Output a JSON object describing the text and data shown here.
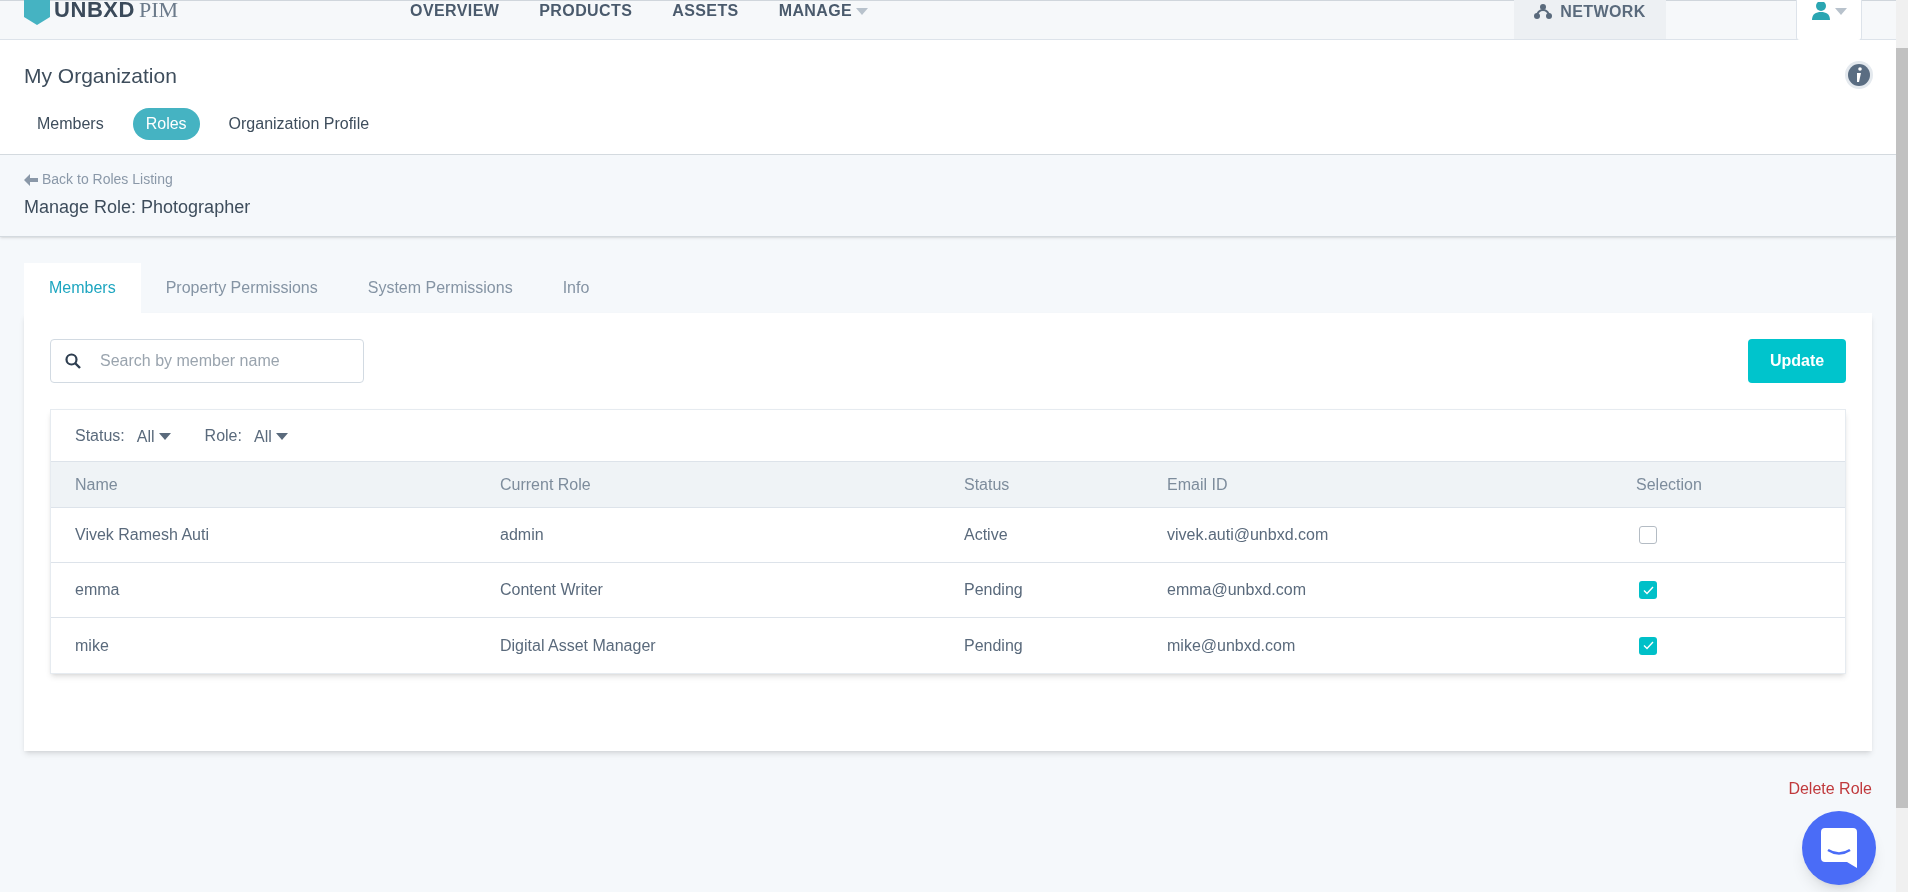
{
  "nav": {
    "logo": "UNBXD",
    "logo_suffix": "PIM",
    "items": [
      {
        "label": "OVERVIEW",
        "dropdown": false
      },
      {
        "label": "PRODUCTS",
        "dropdown": false
      },
      {
        "label": "ASSETS",
        "dropdown": false
      },
      {
        "label": "MANAGE",
        "dropdown": true
      }
    ],
    "network": "NETWORK"
  },
  "header": {
    "title": "My Organization",
    "tabs": [
      {
        "label": "Members",
        "selected": false
      },
      {
        "label": "Roles",
        "selected": true
      },
      {
        "label": "Organization Profile",
        "selected": false
      }
    ]
  },
  "breadcrumb": {
    "back": "Back to Roles Listing",
    "title": "Manage Role: Photographer"
  },
  "tabs": [
    {
      "label": "Members",
      "selected": true
    },
    {
      "label": "Property Permissions",
      "selected": false
    },
    {
      "label": "System Permissions",
      "selected": false
    },
    {
      "label": "Info",
      "selected": false
    }
  ],
  "search": {
    "placeholder": "Search by member name"
  },
  "update_button": "Update",
  "filters": [
    {
      "label": "Status:",
      "value": "All"
    },
    {
      "label": "Role:",
      "value": "All"
    }
  ],
  "table": {
    "columns": [
      "Name",
      "Current Role",
      "Status",
      "Email ID",
      "Selection"
    ],
    "rows": [
      {
        "name": "Vivek Ramesh Auti",
        "role": "admin",
        "status": "Active",
        "email": "vivek.auti@unbxd.com",
        "checked": false
      },
      {
        "name": "emma",
        "role": "Content Writer",
        "status": "Pending",
        "email": "emma@unbxd.com",
        "checked": true
      },
      {
        "name": "mike",
        "role": "Digital Asset Manager",
        "status": "Pending",
        "email": "mike@unbxd.com",
        "checked": true
      }
    ]
  },
  "delete_link": "Delete Role"
}
